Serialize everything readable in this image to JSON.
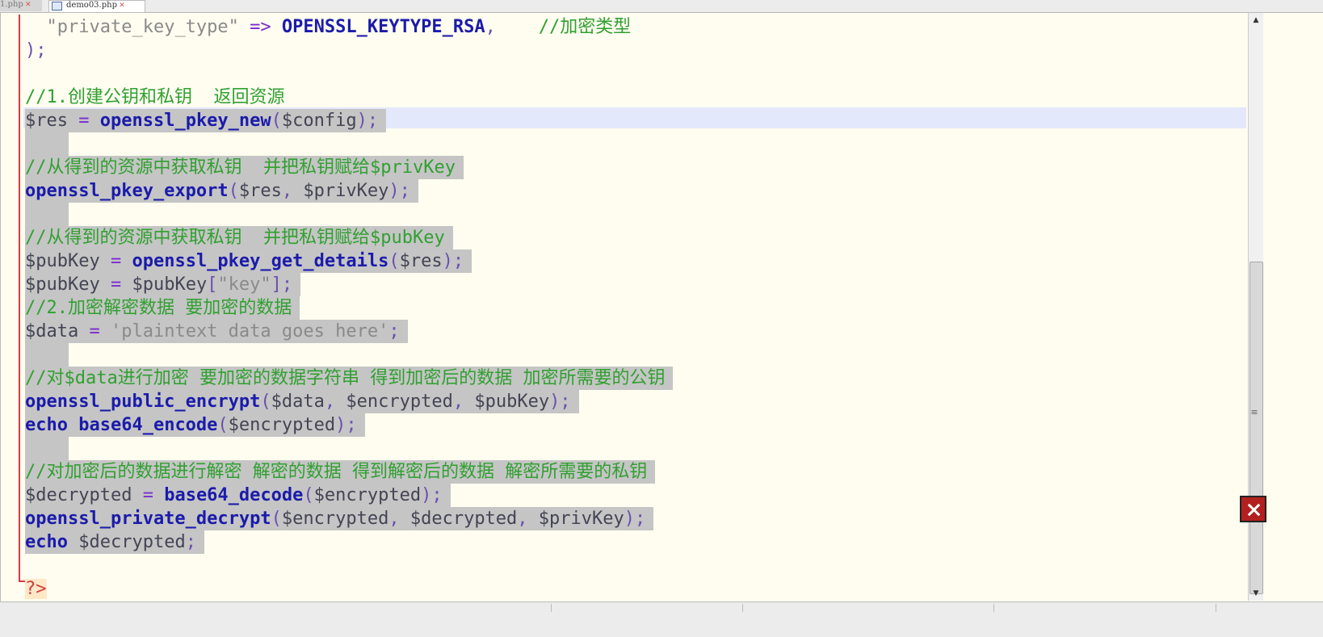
{
  "tabs": [
    {
      "label": "1.php"
    },
    {
      "label": "demo03.php"
    }
  ],
  "editor": {
    "lines": [
      {
        "cls": "",
        "tokens": [
          {
            "t": "  ",
            "c": ""
          },
          {
            "t": "\"private_key_type\"",
            "c": "st"
          },
          {
            "t": " => ",
            "c": "op"
          },
          {
            "t": "OPENSSL_KEYTYPE_RSA",
            "c": "kw"
          },
          {
            "t": ",    ",
            "c": "pn"
          },
          {
            "t": "//加密类型",
            "c": "cm"
          }
        ]
      },
      {
        "cls": "",
        "tokens": [
          {
            "t": ");",
            "c": "pn"
          }
        ]
      },
      {
        "cls": "",
        "tokens": []
      },
      {
        "cls": "",
        "tokens": [
          {
            "t": "//1.创建公钥和私钥  返回资源",
            "c": "cm"
          }
        ]
      },
      {
        "cls": "sel",
        "tokens": [
          {
            "t": "$res",
            "c": "vr"
          },
          {
            "t": " = ",
            "c": "op"
          },
          {
            "t": "openssl_pkey_new",
            "c": "kw"
          },
          {
            "t": "(",
            "c": "pn"
          },
          {
            "t": "$config",
            "c": "vr"
          },
          {
            "t": ");",
            "c": "pn"
          }
        ]
      },
      {
        "cls": "sel blank",
        "tokens": []
      },
      {
        "cls": "sel",
        "tokens": [
          {
            "t": "//从得到的资源中获取私钥  并把私钥赋给$privKey",
            "c": "cm"
          }
        ]
      },
      {
        "cls": "sel",
        "tokens": [
          {
            "t": "openssl_pkey_export",
            "c": "kw"
          },
          {
            "t": "(",
            "c": "pn"
          },
          {
            "t": "$res",
            "c": "vr"
          },
          {
            "t": ", ",
            "c": "pn"
          },
          {
            "t": "$privKey",
            "c": "vr"
          },
          {
            "t": ");",
            "c": "pn"
          }
        ]
      },
      {
        "cls": "sel blank",
        "tokens": []
      },
      {
        "cls": "sel",
        "tokens": [
          {
            "t": "//从得到的资源中获取私钥  并把私钥赋给$pubKey",
            "c": "cm"
          }
        ]
      },
      {
        "cls": "sel",
        "tokens": [
          {
            "t": "$pubKey",
            "c": "vr"
          },
          {
            "t": " = ",
            "c": "op"
          },
          {
            "t": "openssl_pkey_get_details",
            "c": "kw"
          },
          {
            "t": "(",
            "c": "pn"
          },
          {
            "t": "$res",
            "c": "vr"
          },
          {
            "t": ");",
            "c": "pn"
          }
        ]
      },
      {
        "cls": "sel",
        "tokens": [
          {
            "t": "$pubKey",
            "c": "vr"
          },
          {
            "t": " = ",
            "c": "op"
          },
          {
            "t": "$pubKey",
            "c": "vr"
          },
          {
            "t": "[",
            "c": "pn"
          },
          {
            "t": "\"key\"",
            "c": "st"
          },
          {
            "t": "];",
            "c": "pn"
          }
        ]
      },
      {
        "cls": "sel",
        "tokens": [
          {
            "t": "//2.加密解密数据 要加密的数据",
            "c": "cm"
          }
        ]
      },
      {
        "cls": "sel",
        "tokens": [
          {
            "t": "$data",
            "c": "vr"
          },
          {
            "t": " = ",
            "c": "op"
          },
          {
            "t": "'plaintext data goes here'",
            "c": "st"
          },
          {
            "t": ";",
            "c": "pn"
          }
        ]
      },
      {
        "cls": "sel blank",
        "tokens": []
      },
      {
        "cls": "sel",
        "tokens": [
          {
            "t": "//对$data进行加密 要加密的数据字符串 得到加密后的数据 加密所需要的公钥",
            "c": "cm"
          }
        ]
      },
      {
        "cls": "sel",
        "tokens": [
          {
            "t": "openssl_public_encrypt",
            "c": "kw"
          },
          {
            "t": "(",
            "c": "pn"
          },
          {
            "t": "$data",
            "c": "vr"
          },
          {
            "t": ", ",
            "c": "pn"
          },
          {
            "t": "$encrypted",
            "c": "vr"
          },
          {
            "t": ", ",
            "c": "pn"
          },
          {
            "t": "$pubKey",
            "c": "vr"
          },
          {
            "t": ");",
            "c": "pn"
          }
        ]
      },
      {
        "cls": "sel",
        "tokens": [
          {
            "t": "echo",
            "c": "kw"
          },
          {
            "t": " ",
            "c": ""
          },
          {
            "t": "base64_encode",
            "c": "kw"
          },
          {
            "t": "(",
            "c": "pn"
          },
          {
            "t": "$encrypted",
            "c": "vr"
          },
          {
            "t": ");",
            "c": "pn"
          }
        ]
      },
      {
        "cls": "sel blank",
        "tokens": []
      },
      {
        "cls": "sel",
        "tokens": [
          {
            "t": "//对加密后的数据进行解密 解密的数据 得到解密后的数据 解密所需要的私钥",
            "c": "cm"
          }
        ]
      },
      {
        "cls": "sel",
        "tokens": [
          {
            "t": "$decrypted",
            "c": "vr"
          },
          {
            "t": " = ",
            "c": "op"
          },
          {
            "t": "base64_decode",
            "c": "kw"
          },
          {
            "t": "(",
            "c": "pn"
          },
          {
            "t": "$encrypted",
            "c": "vr"
          },
          {
            "t": ");",
            "c": "pn"
          }
        ]
      },
      {
        "cls": "sel",
        "tokens": [
          {
            "t": "openssl_private_decrypt",
            "c": "kw"
          },
          {
            "t": "(",
            "c": "pn"
          },
          {
            "t": "$encrypted",
            "c": "vr"
          },
          {
            "t": ", ",
            "c": "pn"
          },
          {
            "t": "$decrypted",
            "c": "vr"
          },
          {
            "t": ", ",
            "c": "pn"
          },
          {
            "t": "$privKey",
            "c": "vr"
          },
          {
            "t": ");",
            "c": "pn"
          }
        ]
      },
      {
        "cls": "sel",
        "tokens": [
          {
            "t": "echo",
            "c": "kw"
          },
          {
            "t": " ",
            "c": ""
          },
          {
            "t": "$decrypted",
            "c": "vr"
          },
          {
            "t": ";",
            "c": "pn"
          }
        ]
      },
      {
        "cls": "",
        "tokens": []
      },
      {
        "cls": "",
        "tokens": [
          {
            "t": "?>",
            "c": "tag"
          }
        ]
      }
    ]
  },
  "colors": {
    "background": "#fffdf0",
    "selection": "#c5c5c5",
    "current_line": "#e4e8fb",
    "keyword": "#1b1bab",
    "comment": "#30a030",
    "gutter_marker": "#d23c3c"
  },
  "icons": {
    "tab_close": "close-icon",
    "scroll_up": "arrow-up-icon",
    "scroll_down": "arrow-down-icon",
    "app_badge": "app-badge-icon"
  }
}
